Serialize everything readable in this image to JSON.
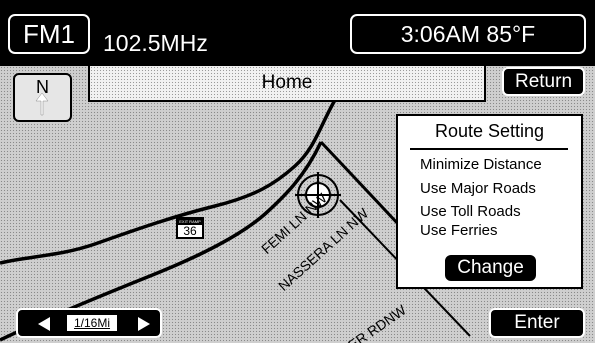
{
  "header": {
    "band": "FM1",
    "frequency": "102.5MHz",
    "clock_temp": "3:06AM 85°F"
  },
  "destination_bar": {
    "label": "Home"
  },
  "compass": {
    "label": "N",
    "icon": "north-arrow-icon"
  },
  "buttons": {
    "return": "Return",
    "enter": "Enter",
    "change": "Change"
  },
  "route_setting": {
    "title": "Route Setting",
    "options": [
      "Minimize Distance",
      "Use Major Roads",
      "Use Toll Roads",
      "Use Ferries"
    ]
  },
  "map_scale": {
    "value": "1/16Mi",
    "left_icon": "arrow-left-icon",
    "right_icon": "arrow-right-icon"
  },
  "map": {
    "streets": [
      "FEMI LN NW",
      "NASSERA LN NW",
      "ER RDNW"
    ],
    "exit_sign": {
      "label": "EXIT RAMP",
      "number": "36"
    },
    "vehicle_icon": "vehicle-position-icon"
  }
}
